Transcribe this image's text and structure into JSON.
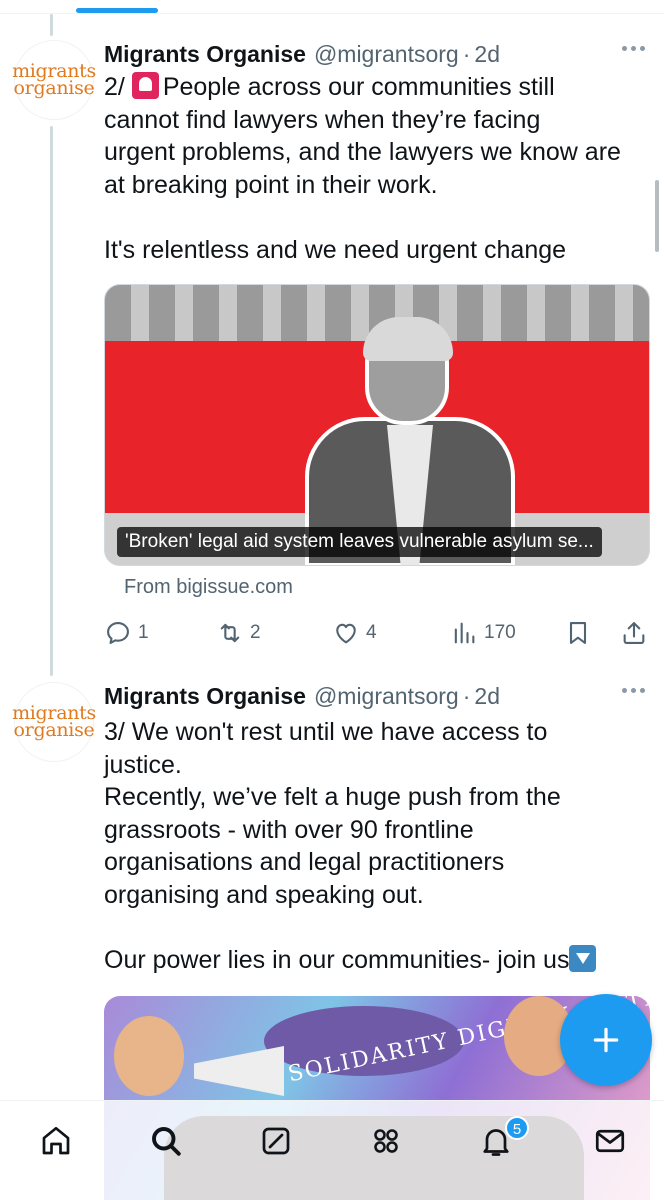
{
  "tweets": [
    {
      "author_name": "Migrants Organise",
      "handle": "@migrantsorg",
      "separator": "·",
      "time": "2d",
      "avatar_text": [
        "migrants",
        "organise"
      ],
      "lines": [
        "People across our communities still",
        "cannot find lawyers when they’re facing",
        "urgent problems, and the lawyers we know are",
        "at breaking point in their work.",
        "",
        "It's relentless and we need urgent change"
      ],
      "prefix": "2/",
      "emoji": "rotating-light",
      "link_card": {
        "caption": "'Broken' legal aid system leaves vulnerable asylum se...",
        "source": "From bigissue.com"
      },
      "stats": {
        "replies": "1",
        "retweets": "2",
        "likes": "4",
        "views": "170"
      }
    },
    {
      "author_name": "Migrants Organise",
      "handle": "@migrantsorg",
      "separator": "·",
      "time": "2d",
      "avatar_text": [
        "migrants",
        "organise"
      ],
      "lines": [
        "3/ We won't rest until we have access to",
        "justice.",
        "Recently, we’ve felt a huge push from the",
        "grassroots - with over 90 frontline",
        "organisations and legal practitioners",
        "organising and speaking out.",
        "",
        "Our power lies in our communities- join us"
      ],
      "end_emoji": "down-arrow",
      "image_banner_text": "SOLIDARITY DIGNITY JUSTICE"
    }
  ],
  "tabbar": {
    "items": [
      "home",
      "search",
      "grok",
      "communities",
      "notifications",
      "messages"
    ],
    "notification_count": "5"
  },
  "colors": {
    "accent": "#1d9bf0",
    "secondary_text": "#536471",
    "avatar_orange": "#e07a1f",
    "card_red": "#e8232a"
  }
}
